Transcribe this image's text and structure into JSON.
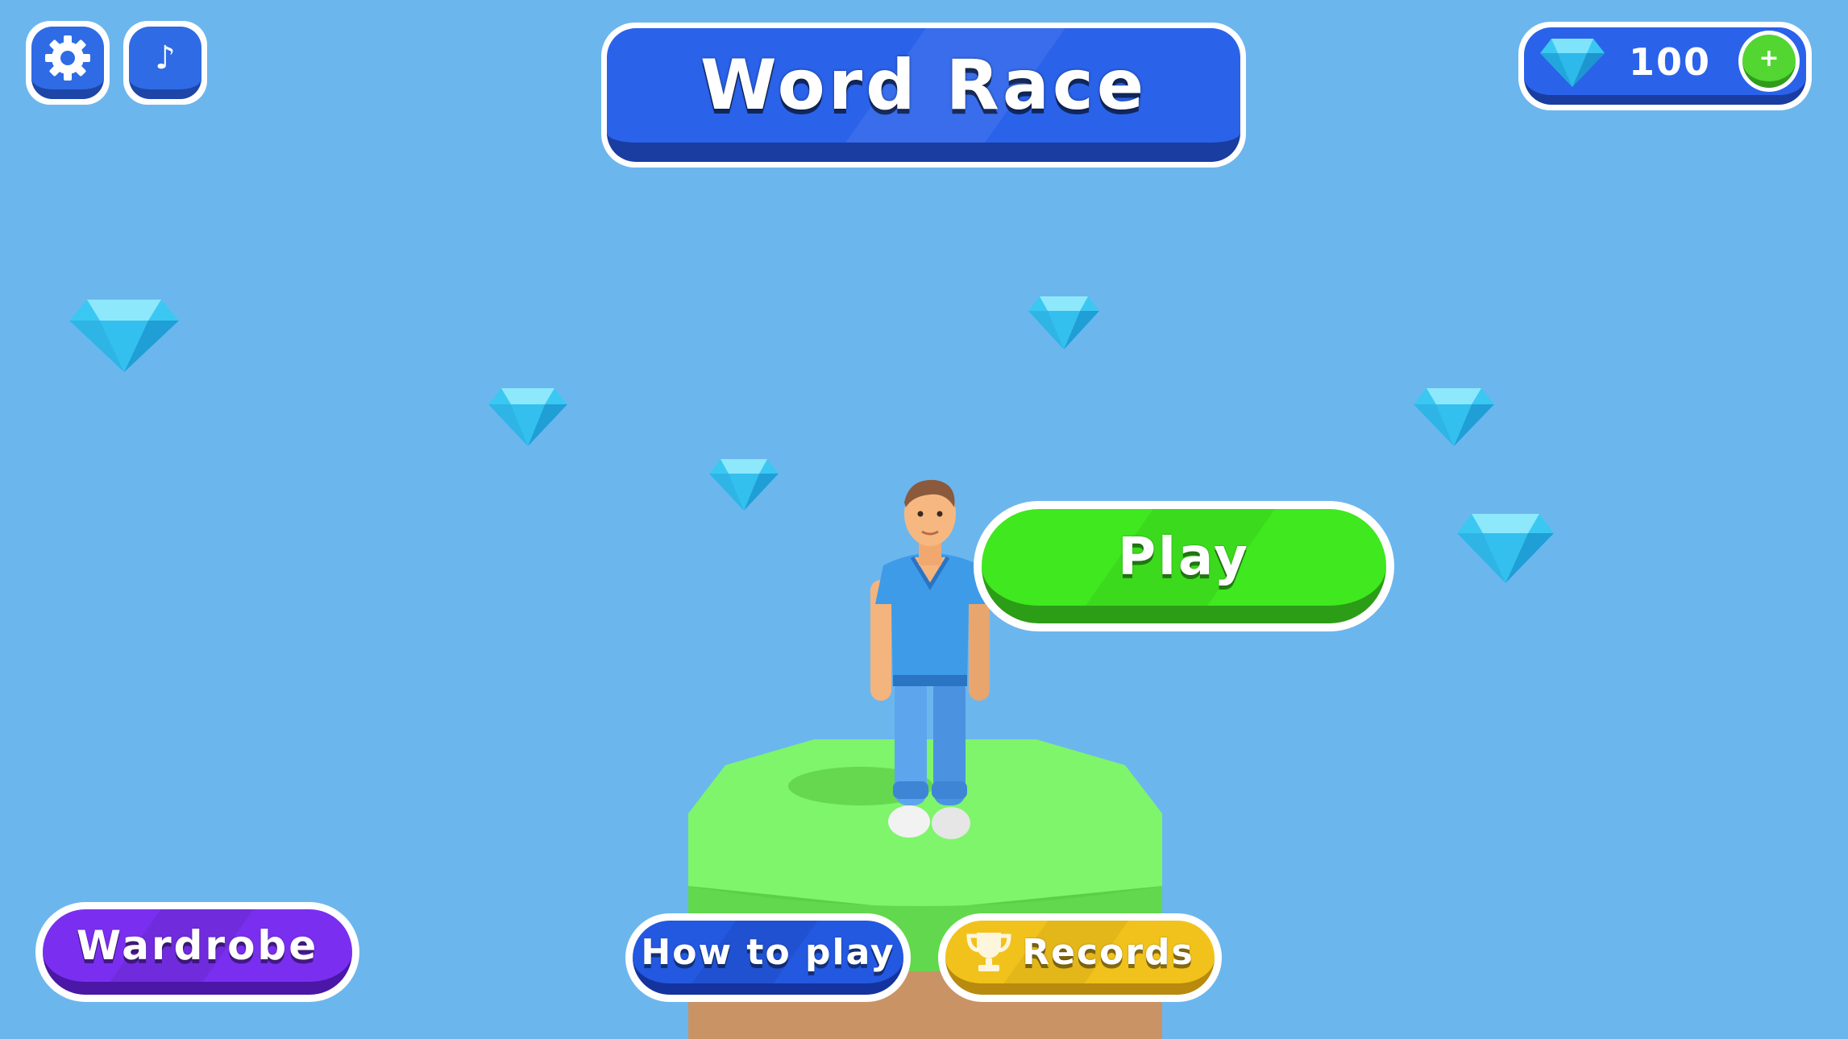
{
  "title": "Word Race",
  "top_bar": {
    "settings_icon": "gear-icon",
    "music_icon": "music-note-icon",
    "music_glyph": "♪"
  },
  "gems": {
    "count": "100",
    "add_glyph": "+",
    "icon": "diamond-icon"
  },
  "buttons": {
    "play": "Play",
    "wardrobe": "Wardrobe",
    "how_to_play": "How to play",
    "records": "Records"
  },
  "colors": {
    "sky": "#6cb6ee",
    "play_green": "#3fe81f",
    "wardrobe_purple": "#7a2ff0",
    "how_to_blue": "#2358e0",
    "records_yellow": "#f2c21c",
    "banner_blue": "#2a62ea",
    "platform_green": "#7ef56b"
  }
}
